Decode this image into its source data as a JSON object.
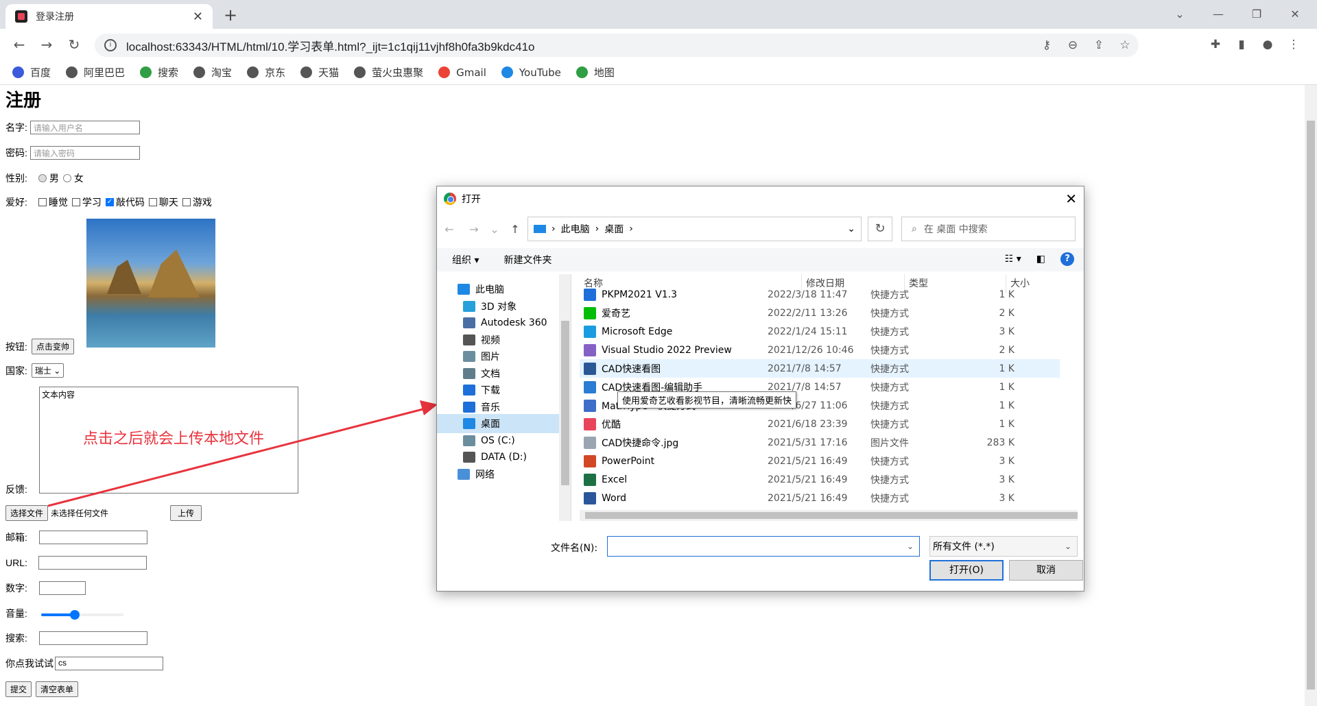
{
  "browser": {
    "tab_title": "登录注册",
    "url": "localhost:63343/HTML/html/10.学习表单.html?_ijt=1c1qij11vjhf8h0fa3b9kdc41o",
    "bookmarks": [
      "百度",
      "阿里巴巴",
      "搜索",
      "淘宝",
      "京东",
      "天猫",
      "萤火虫惠聚",
      "Gmail",
      "YouTube",
      "地图"
    ]
  },
  "form": {
    "heading": "注册",
    "name_label": "名字:",
    "name_placeholder": "请输入用户名",
    "pwd_label": "密码:",
    "pwd_placeholder": "请输入密码",
    "gender_label": "性别:",
    "gender_male": "男",
    "gender_female": "女",
    "hobby_label": "爱好:",
    "hobbies": [
      {
        "label": "睡觉",
        "checked": false
      },
      {
        "label": "学习",
        "checked": false
      },
      {
        "label": "敲代码",
        "checked": true
      },
      {
        "label": "聊天",
        "checked": false
      },
      {
        "label": "游戏",
        "checked": false
      }
    ],
    "button_label": "按钮:",
    "button_text": "点击变帅",
    "country_label": "国家:",
    "country_value": "瑞士",
    "textarea_value": "文本内容",
    "feedback_label": "反馈:",
    "file_button": "选择文件",
    "file_status": "未选择任何文件",
    "upload_button": "上传",
    "email_label": "邮箱:",
    "url_label": "URL:",
    "number_label": "数字:",
    "volume_label": "音量:",
    "volume_level": 0.4,
    "search_label": "搜索:",
    "try_label": "你点我试试",
    "try_value": "cs",
    "submit": "提交",
    "reset": "清空表单"
  },
  "annotation": "点击之后就会上传本地文件",
  "dialog": {
    "title": "打开",
    "path": [
      "此电脑",
      "桌面"
    ],
    "search_placeholder": "在 桌面 中搜索",
    "organize": "组织 ▾",
    "new_folder": "新建文件夹",
    "nav": [
      "此电脑",
      "3D 对象",
      "Autodesk 360",
      "视频",
      "图片",
      "文档",
      "下载",
      "音乐",
      "桌面",
      "OS (C:)",
      "DATA (D:)",
      "网络"
    ],
    "columns": [
      "名称",
      "修改日期",
      "类型",
      "大小"
    ],
    "files": [
      {
        "name": "PKPM2021 V1.3",
        "date": "2022/3/18 11:47",
        "type": "快捷方式",
        "size": "1 K",
        "color": "#1e6fd9"
      },
      {
        "name": "爱奇艺",
        "date": "2022/2/11 13:26",
        "type": "快捷方式",
        "size": "2 K",
        "color": "#00be06"
      },
      {
        "name": "Microsoft Edge",
        "date": "2022/1/24 15:11",
        "type": "快捷方式",
        "size": "3 K",
        "color": "#1a9de0"
      },
      {
        "name": "Visual Studio 2022 Preview",
        "date": "2021/12/26 10:46",
        "type": "快捷方式",
        "size": "2 K",
        "color": "#8661c5"
      },
      {
        "name": "CAD快速看图",
        "date": "2021/7/8 14:57",
        "type": "快捷方式",
        "size": "1 K",
        "color": "#2b5797"
      },
      {
        "name": "CAD快速看图-编辑助手",
        "date": "2021/7/8 14:57",
        "type": "快捷方式",
        "size": "1 K",
        "color": "#2b7cd3"
      },
      {
        "name": "MathType - 快捷方式",
        "date": "2021/6/27 11:06",
        "type": "快捷方式",
        "size": "1 K",
        "color": "#3d6ec9"
      },
      {
        "name": "优酷",
        "date": "2021/6/18 23:39",
        "type": "快捷方式",
        "size": "1 K",
        "color": "#e8455b"
      },
      {
        "name": "CAD快捷命令.jpg",
        "date": "2021/5/31 17:16",
        "type": "图片文件",
        "size": "283 K",
        "color": "#9aa5b1"
      },
      {
        "name": "PowerPoint",
        "date": "2021/5/21 16:49",
        "type": "快捷方式",
        "size": "3 K",
        "color": "#d24726"
      },
      {
        "name": "Excel",
        "date": "2021/5/21 16:49",
        "type": "快捷方式",
        "size": "3 K",
        "color": "#1d7044"
      },
      {
        "name": "Word",
        "date": "2021/5/21 16:49",
        "type": "快捷方式",
        "size": "3 K",
        "color": "#2b579a"
      }
    ],
    "tooltip": "使用爱奇艺收看影视节目，清晰流畅更新快",
    "filename_label": "文件名(N):",
    "filetype": "所有文件 (*.*)",
    "open": "打开(O)",
    "cancel": "取消"
  }
}
